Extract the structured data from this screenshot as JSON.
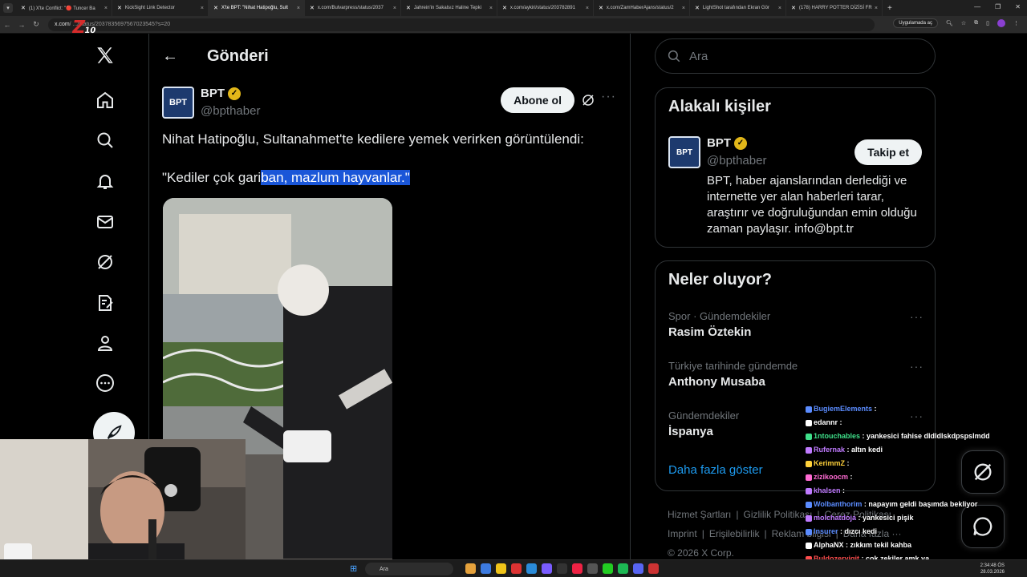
{
  "browser": {
    "tabs": [
      {
        "label": "(1) X'te Conflict: \"🔴 Tuncer Ba",
        "active": false
      },
      {
        "label": "KickSight Link Detector",
        "active": false
      },
      {
        "label": "X'te BPT: \"Nihat Hatipoğlu, Sult",
        "active": true
      },
      {
        "label": "x.com/Bulvarpress/status/2037",
        "active": false
      },
      {
        "label": "Jahrein'in Sakalsız Haline Tepki",
        "active": false
      },
      {
        "label": "x.com/aykiri/status/203782891",
        "active": false
      },
      {
        "label": "x.com/ZamHaberAjans/status/2",
        "active": false
      },
      {
        "label": "LightShot tarafından Ekran Gör",
        "active": false
      },
      {
        "label": "(178) HARRY POTTER DİZİSİ FR",
        "active": false
      }
    ],
    "url_host": "x.com",
    "url_path": "/ .../status/2037835697567023545?s=20",
    "app_pill": "Uygulamada aç"
  },
  "overlay_logo": {
    "letter": "Z",
    "suffix": "10"
  },
  "header": {
    "back_icon": "←",
    "title": "Gönderi"
  },
  "post": {
    "author_name": "BPT",
    "author_handle": "@bpthaber",
    "avatar_text": "BPT",
    "follow_label": "Abone ol",
    "more": "···",
    "line1": "Nihat Hatipoğlu, Sultanahmet'te kedilere yemek verirken görüntülendi:",
    "line2_plain": "\"Kediler çok gari",
    "line2_highlight": "ban, mazlum hayvanlar.\""
  },
  "search": {
    "placeholder": "Ara"
  },
  "related": {
    "title": "Alakalı kişiler",
    "name": "BPT",
    "handle": "@bpthaber",
    "follow_label": "Takip et",
    "bio": "BPT, haber ajanslarından derlediği ve internette yer alan haberleri tarar, araştırır ve doğruluğundan emin olduğu zaman paylaşır. info@bpt.tr"
  },
  "trends": {
    "title": "Neler oluyor?",
    "items": [
      {
        "category": "Spor · Gündemdekiler",
        "name": "Rasim Öztekin"
      },
      {
        "category": "Türkiye tarihinde gündemde",
        "name": "Anthony Musaba"
      },
      {
        "category": "Gündemdekiler",
        "name": "İspanya"
      }
    ],
    "show_more": "Daha fazla göster"
  },
  "footer": {
    "links": [
      "Hizmet Şartları",
      "|",
      "Gizlilik Politikası",
      "|",
      "Çerez Politikası"
    ],
    "links2": [
      "Imprint",
      "|",
      "Erişilebilirlik",
      "|",
      "Reklam bilgisi",
      "|",
      "Daha fazla ···"
    ],
    "copyright": "© 2026 X Corp."
  },
  "chat": [
    {
      "user": "BugiemElements",
      "msg": "",
      "color": "#5b8cff"
    },
    {
      "user": "edannr",
      "msg": "",
      "color": "#ffffff"
    },
    {
      "user": "1ntouchables",
      "msg": "yankesici fahise dldldlskdpspslmddpldldls",
      "color": "#3fe08a"
    },
    {
      "user": "Rufernak",
      "msg": "altın kedi",
      "color": "#c07bff"
    },
    {
      "user": "KerimmZ",
      "msg": "",
      "color": "#ffd13b"
    },
    {
      "user": "zizikoocm",
      "msg": "",
      "color": "#ff6bd3"
    },
    {
      "user": "khalsen",
      "msg": "",
      "color": "#c07bff"
    },
    {
      "user": "Wolbanthorim",
      "msg": "napayım geldi başımda bekliyor",
      "color": "#5b8cff"
    },
    {
      "user": "molchatdoja",
      "msg": "yankesici pişik",
      "color": "#c07bff"
    },
    {
      "user": "Insurer",
      "msg": "dızcı kedi",
      "color": "#5b8cff"
    },
    {
      "user": "AlphaNX",
      "msg": "zıkkım tekil kahba",
      "color": "#ffffff"
    },
    {
      "user": "Buldozeryigit",
      "msg": "çok zekiler amk ya",
      "color": "#ff4d4d"
    }
  ],
  "taskbar": {
    "search": "Ara",
    "time": "2:34:48 ÖS",
    "date": "28.03.2026"
  },
  "colors": {
    "accent": "#1d9bf0",
    "verified": "#e2b719",
    "highlight": "#1a56d8"
  }
}
